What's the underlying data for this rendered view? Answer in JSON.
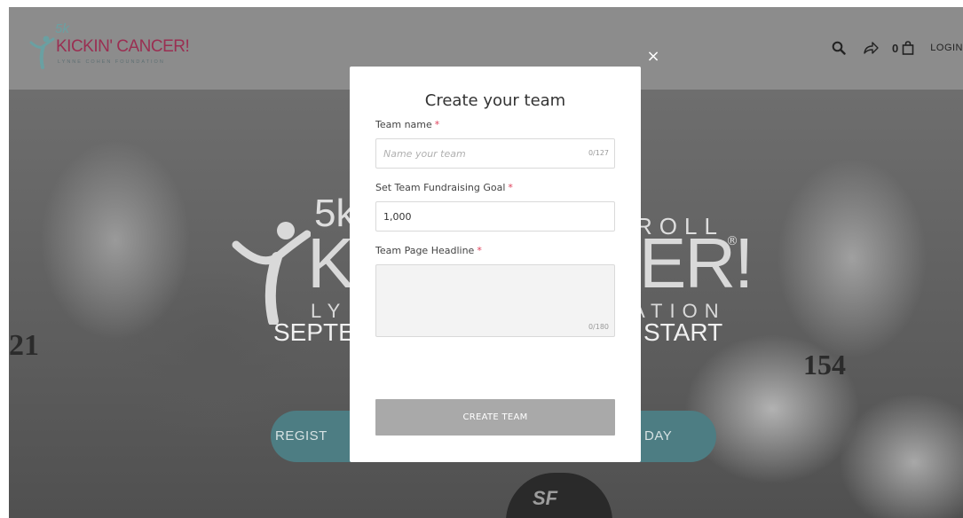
{
  "header": {
    "logo": {
      "prefix": "5k",
      "title": "KICKIN' CANCER!",
      "subtitle": "LYNNE COHEN FOUNDATION"
    },
    "icons": [
      "search-icon",
      "share-icon",
      "bag-icon"
    ],
    "cart_count": "0",
    "login_label": "LOGIN",
    "close_glyph": "×"
  },
  "hero": {
    "logo_prefix": "5k",
    "logo_left": "KI",
    "logo_right": "ER!",
    "logo_reg": "®",
    "roll_text": "ROLL",
    "sub_left": "LY",
    "sub_right": "ATION",
    "date_left": "SEPTE",
    "date_right": "START",
    "button_left": "REGIST",
    "button_right": "DAY",
    "cap_text": "SF",
    "bib_left": "21",
    "bib_right": "154"
  },
  "modal": {
    "title": "Create your team",
    "fields": {
      "team_name": {
        "label": "Team name",
        "required_mark": "*",
        "placeholder": "Name your team",
        "value": "",
        "counter": "0/127"
      },
      "goal": {
        "label": "Set Team Fundraising Goal",
        "required_mark": "*",
        "value": "1,000"
      },
      "headline": {
        "label": "Team Page Headline",
        "required_mark": "*",
        "value": "",
        "counter": "0/180"
      }
    },
    "submit_label": "CREATE TEAM"
  },
  "colors": {
    "brand_magenta": "#9a2f52",
    "brand_teal": "#6aa0a2",
    "required_red": "#e0405b",
    "button_gray": "#a9a9a9",
    "hero_button_teal": "#4d7d83"
  }
}
